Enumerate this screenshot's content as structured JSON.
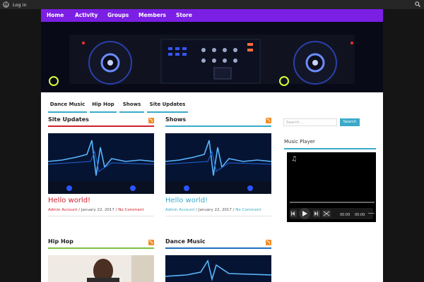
{
  "adminbar": {
    "wp_logo": "W",
    "login_label": "Log in",
    "search_icon": "search-icon"
  },
  "topnav": [
    "Home",
    "Activity",
    "Groups",
    "Members",
    "Store"
  ],
  "subnav": [
    "Dance Music",
    "Hip Hop",
    "Shows",
    "Site Updates"
  ],
  "sections": [
    {
      "title": "Site Updates",
      "accent": "#d0202e",
      "post_title": "Hello world!",
      "title_color": "#d0202e",
      "author": "Admin Account",
      "date": "January 22, 2017",
      "comments": "No Comment"
    },
    {
      "title": "Shows",
      "accent": "#3aaac9",
      "post_title": "Hello world!",
      "title_color": "#3aaac9",
      "author": "Admin Account",
      "date": "January 22, 2017",
      "comments": "No Comment"
    },
    {
      "title": "Hip Hop",
      "accent": "#7cc142",
      "post_title": "",
      "title_color": "",
      "author": "",
      "date": "",
      "comments": ""
    },
    {
      "title": "Dance Music",
      "accent": "#1e6fc1",
      "post_title": "",
      "title_color": "",
      "author": "",
      "date": "",
      "comments": ""
    }
  ],
  "sidebar": {
    "search_placeholder": "Search ...",
    "search_button": "Search",
    "music_player_title": "Music Player",
    "player": {
      "current_time": "00:00",
      "duration": "00:00"
    }
  },
  "colors": {
    "nav": "#7b1fe4",
    "accent": "#3aaac9",
    "rss": "#f48d25"
  }
}
